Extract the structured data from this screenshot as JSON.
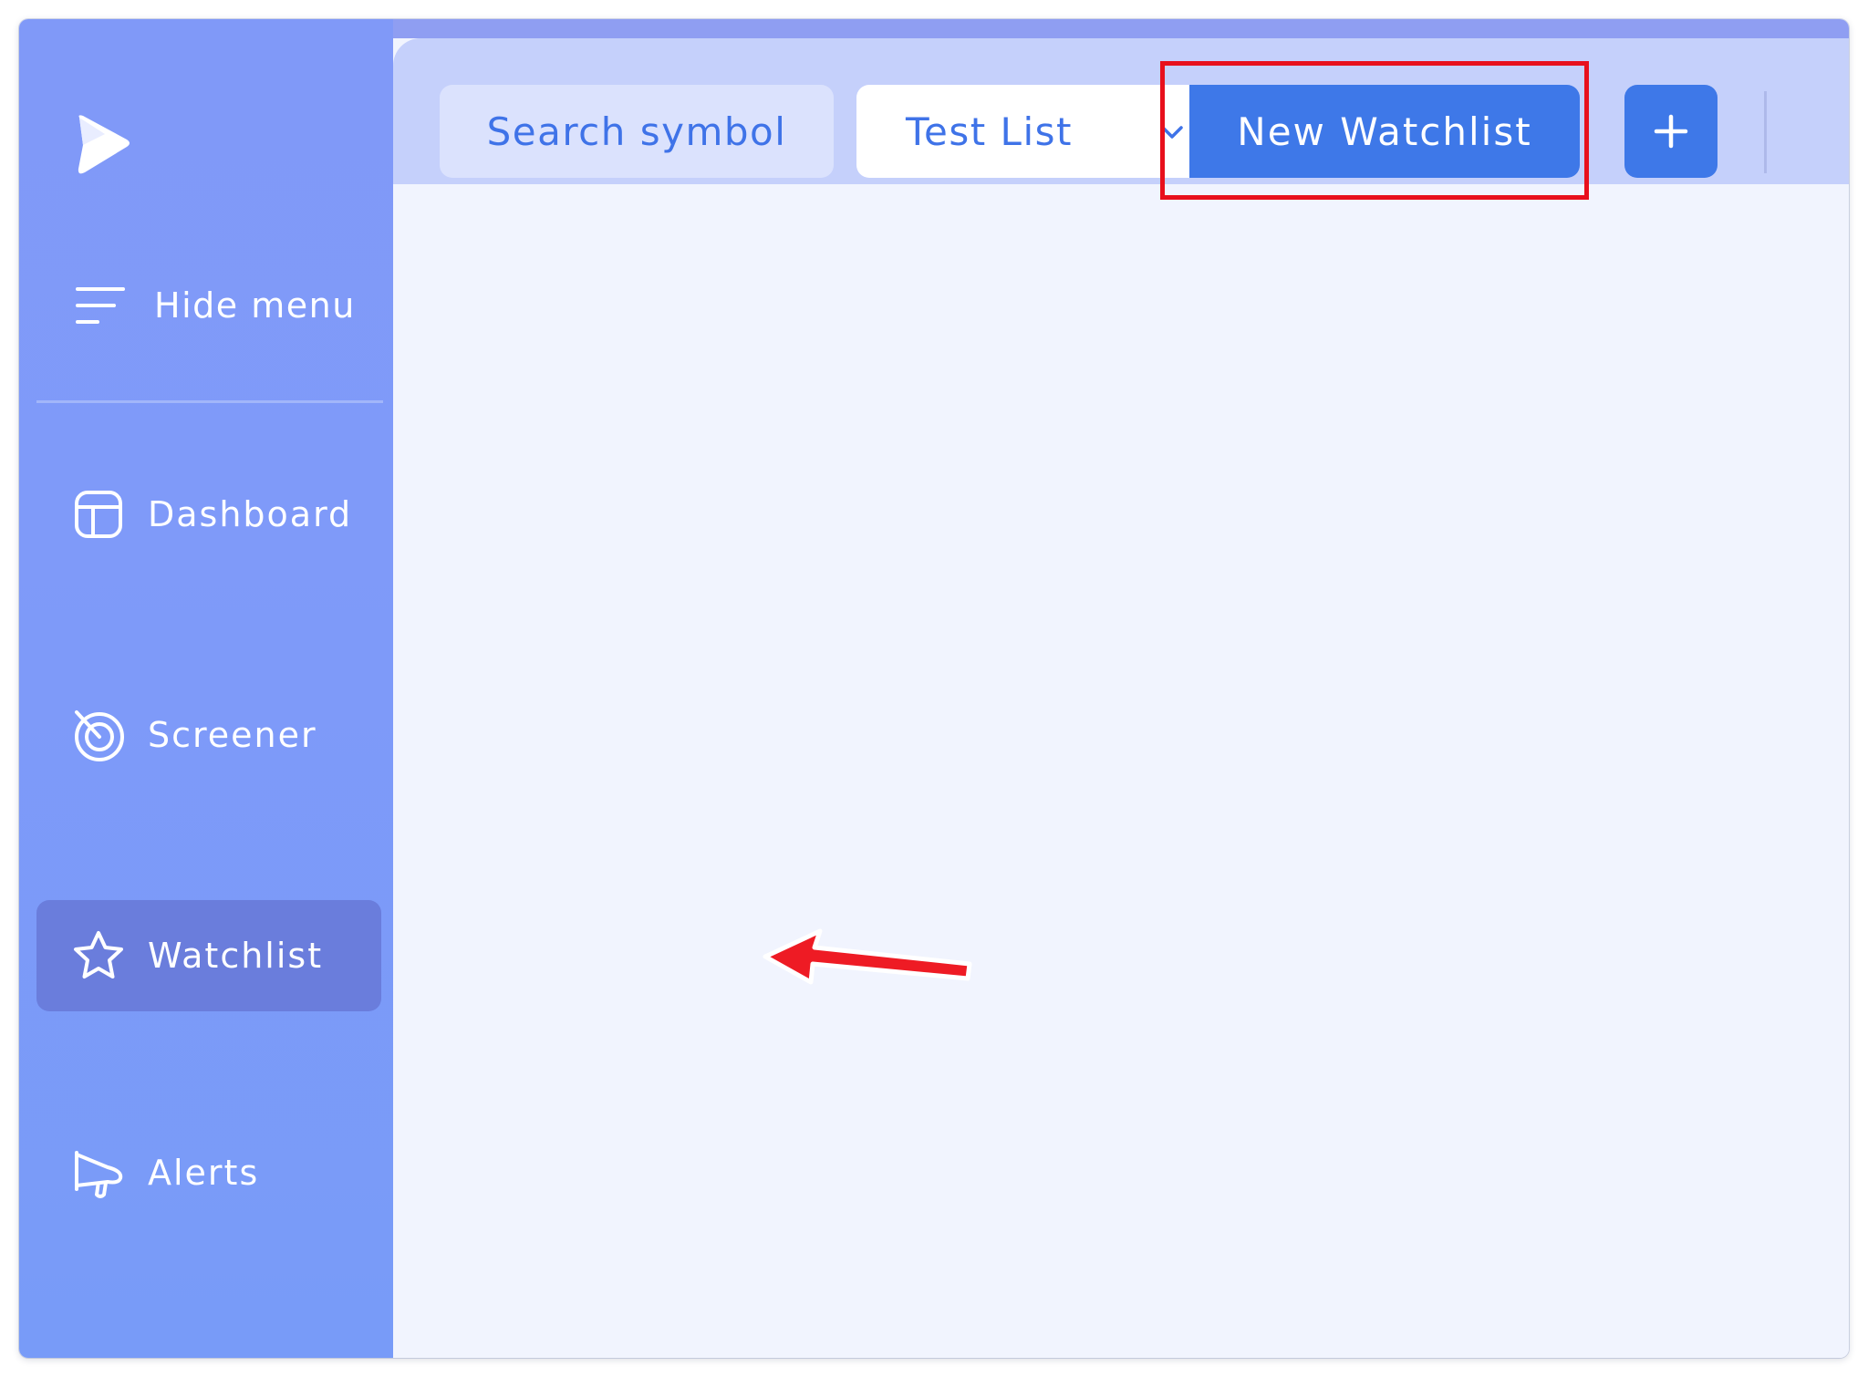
{
  "sidebar": {
    "hide_menu_label": "Hide menu",
    "items": [
      {
        "label": "Dashboard",
        "icon": "dashboard-icon"
      },
      {
        "label": "Screener",
        "icon": "radar-icon"
      },
      {
        "label": "Watchlist",
        "icon": "star-icon",
        "active": true
      },
      {
        "label": "Alerts",
        "icon": "megaphone-icon"
      }
    ]
  },
  "topbar": {
    "search_placeholder": "Search symbol",
    "selected_list": "Test List",
    "new_watchlist_label": "New Watchlist",
    "add_label": "+"
  },
  "colors": {
    "sidebar": "#7f9af9",
    "active_item": "#6a7ddc",
    "primary_button": "#3e78e8",
    "topbar": "#c5d0fb",
    "content_bg": "#f1f4fe",
    "highlight": "#e8101c"
  }
}
